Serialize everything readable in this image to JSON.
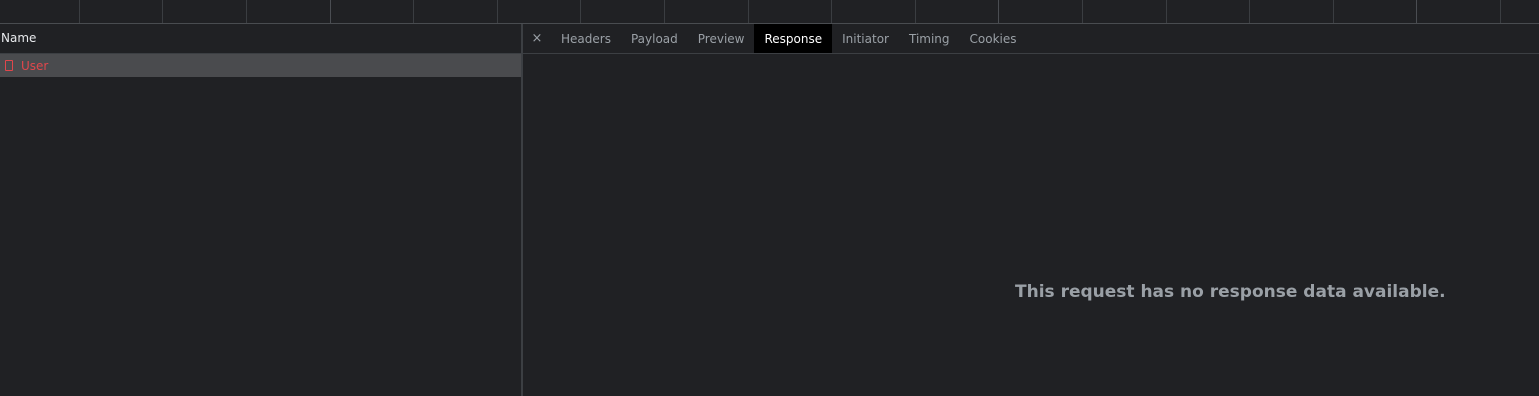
{
  "requests_panel": {
    "column_header": "Name",
    "requests": [
      {
        "name": "User",
        "status_color": "#e0474c"
      }
    ]
  },
  "details_panel": {
    "close_icon": "close-icon",
    "close_glyph": "×",
    "tabs": [
      {
        "label": "Headers"
      },
      {
        "label": "Payload"
      },
      {
        "label": "Preview"
      },
      {
        "label": "Response",
        "active": true
      },
      {
        "label": "Initiator"
      },
      {
        "label": "Timing"
      },
      {
        "label": "Cookies"
      }
    ],
    "empty_message": "This request has no response data available."
  },
  "colors": {
    "background": "#202124",
    "selected_row": "#4a4b4e",
    "error_text": "#e0474c",
    "active_tab": "#000000"
  }
}
